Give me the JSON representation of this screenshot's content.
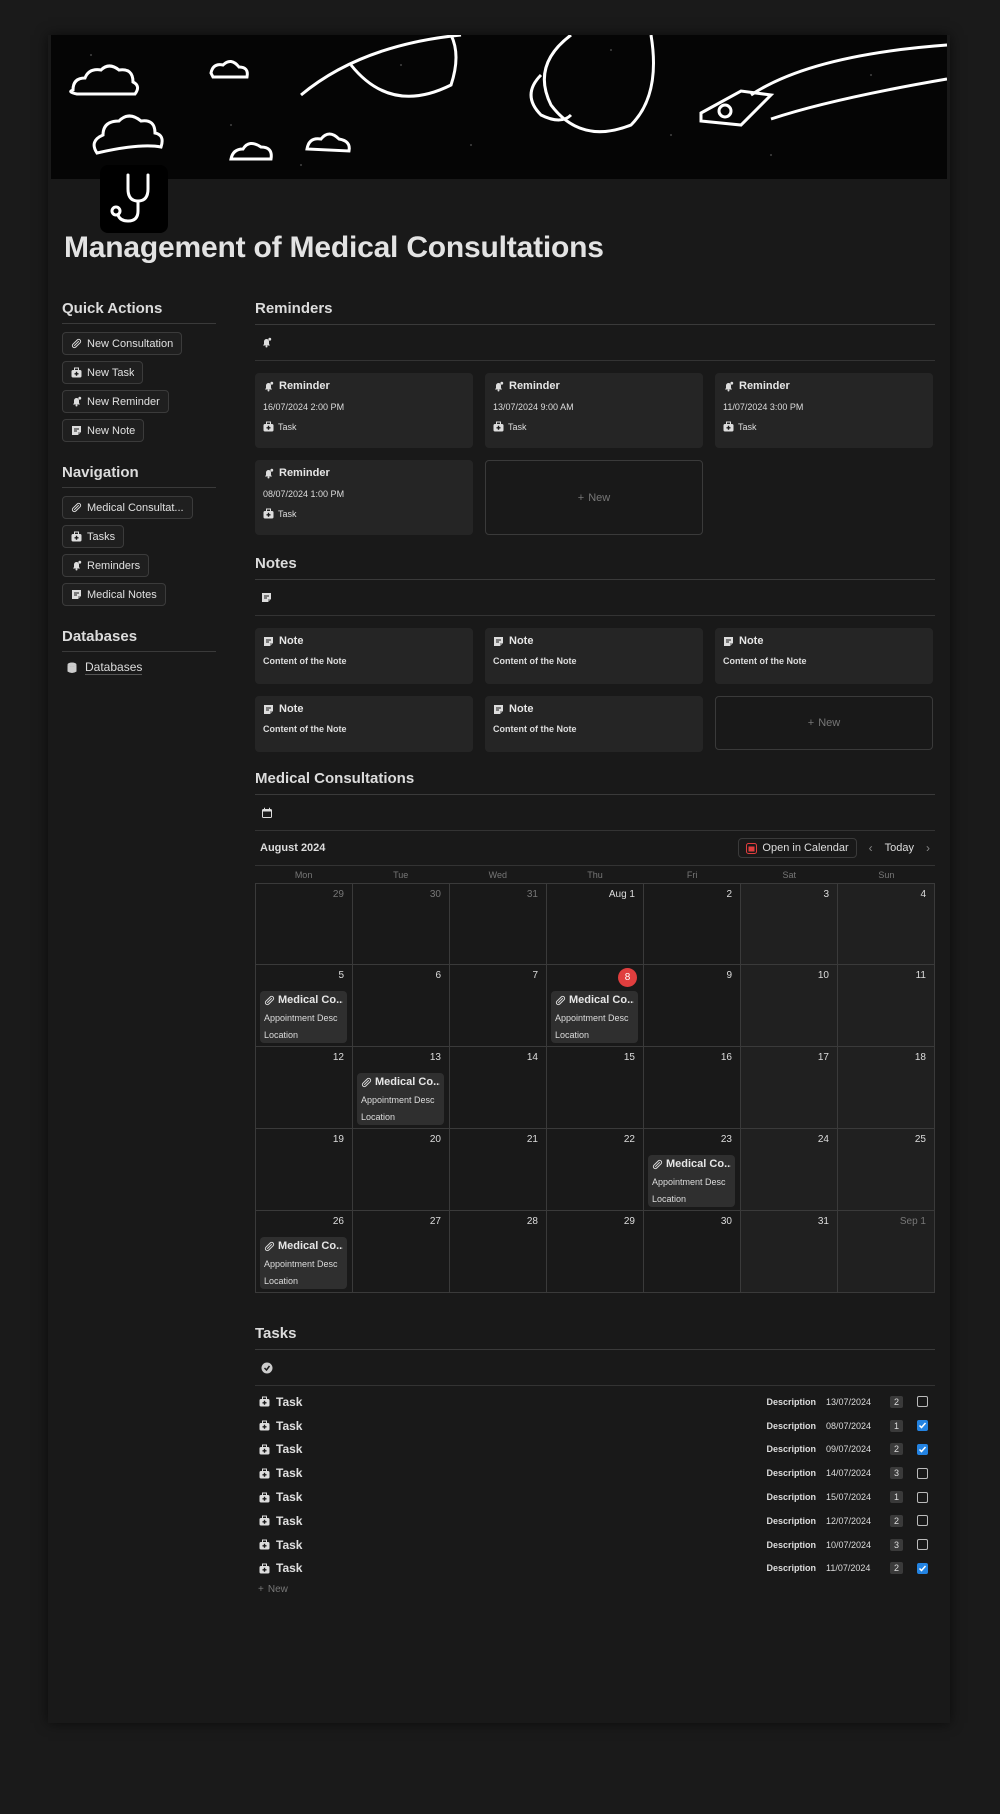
{
  "page": {
    "title": "Management of Medical Consultations"
  },
  "sidebar": {
    "quick_actions": {
      "heading": "Quick Actions",
      "items": [
        {
          "label": "New Consultation",
          "icon": "pill-icon"
        },
        {
          "label": "New Task",
          "icon": "medical-kit-icon"
        },
        {
          "label": "New Reminder",
          "icon": "bell-icon"
        },
        {
          "label": "New Note",
          "icon": "note-icon"
        }
      ]
    },
    "navigation": {
      "heading": "Navigation",
      "items": [
        {
          "label": "Medical Consultat...",
          "icon": "pill-icon"
        },
        {
          "label": "Tasks",
          "icon": "medical-kit-icon"
        },
        {
          "label": "Reminders",
          "icon": "bell-icon"
        },
        {
          "label": "Medical Notes",
          "icon": "note-icon"
        }
      ]
    },
    "databases": {
      "heading": "Databases",
      "link": "Databases"
    }
  },
  "reminders": {
    "heading": "Reminders",
    "cards": [
      {
        "title": "Reminder",
        "date": "16/07/2024 2:00 PM",
        "tag": "Task"
      },
      {
        "title": "Reminder",
        "date": "13/07/2024 9:00 AM",
        "tag": "Task"
      },
      {
        "title": "Reminder",
        "date": "11/07/2024 3:00 PM",
        "tag": "Task"
      },
      {
        "title": "Reminder",
        "date": "08/07/2024 1:00 PM",
        "tag": "Task"
      }
    ],
    "new_label": "New"
  },
  "notes": {
    "heading": "Notes",
    "cards": [
      {
        "title": "Note",
        "content": "Content of the Note"
      },
      {
        "title": "Note",
        "content": "Content of the Note"
      },
      {
        "title": "Note",
        "content": "Content of the Note"
      },
      {
        "title": "Note",
        "content": "Content of the Note"
      },
      {
        "title": "Note",
        "content": "Content of the Note"
      }
    ],
    "new_label": "New"
  },
  "consultations": {
    "heading": "Medical Consultations",
    "month": "August 2024",
    "open_in_calendar": "Open in Calendar",
    "today": "Today",
    "weekdays": [
      "Mon",
      "Tue",
      "Wed",
      "Thu",
      "Fri",
      "Sat",
      "Sun"
    ],
    "days": [
      "29",
      "30",
      "31",
      "Aug 1",
      "2",
      "3",
      "4",
      "5",
      "6",
      "7",
      "8",
      "9",
      "10",
      "11",
      "12",
      "13",
      "14",
      "15",
      "16",
      "17",
      "18",
      "19",
      "20",
      "21",
      "22",
      "23",
      "24",
      "25",
      "26",
      "27",
      "28",
      "29",
      "30",
      "31",
      "Sep 1"
    ],
    "today_day": "8",
    "event": {
      "title": "Medical Co...",
      "desc": "Appointment Desc",
      "location": "Location"
    },
    "event_days": [
      "5",
      "8",
      "13",
      "23",
      "26"
    ]
  },
  "tasks": {
    "heading": "Tasks",
    "rows": [
      {
        "name": "Task",
        "desc": "Description",
        "date": "13/07/2024",
        "priority": "2",
        "done": false
      },
      {
        "name": "Task",
        "desc": "Description",
        "date": "08/07/2024",
        "priority": "1",
        "done": true
      },
      {
        "name": "Task",
        "desc": "Description",
        "date": "09/07/2024",
        "priority": "2",
        "done": true
      },
      {
        "name": "Task",
        "desc": "Description",
        "date": "14/07/2024",
        "priority": "3",
        "done": false
      },
      {
        "name": "Task",
        "desc": "Description",
        "date": "15/07/2024",
        "priority": "1",
        "done": false
      },
      {
        "name": "Task",
        "desc": "Description",
        "date": "12/07/2024",
        "priority": "2",
        "done": false
      },
      {
        "name": "Task",
        "desc": "Description",
        "date": "10/07/2024",
        "priority": "3",
        "done": false
      },
      {
        "name": "Task",
        "desc": "Description",
        "date": "11/07/2024",
        "priority": "2",
        "done": true
      }
    ],
    "new_label": "New"
  },
  "colors": {
    "accent_blue": "#2383e2",
    "today_red": "#e03e3e"
  }
}
